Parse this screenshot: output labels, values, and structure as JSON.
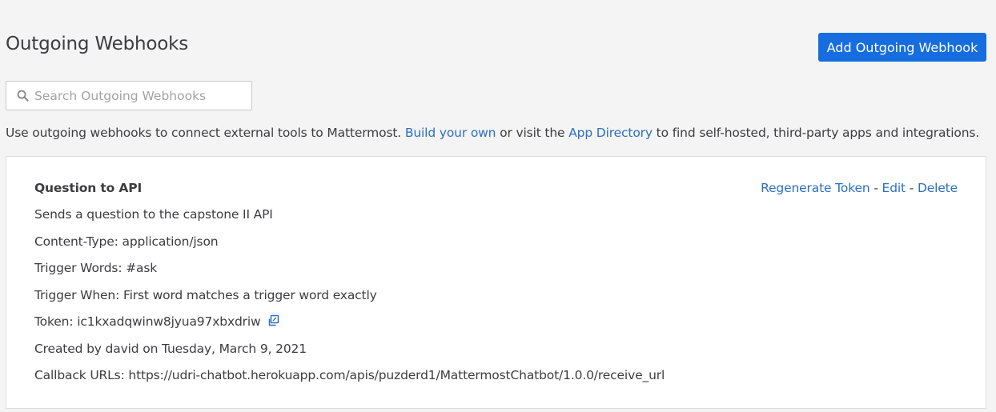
{
  "header": {
    "title": "Outgoing Webhooks",
    "add_button_label": "Add Outgoing Webhook"
  },
  "search": {
    "placeholder": "Search Outgoing Webhooks",
    "value": ""
  },
  "intro": {
    "text_before": "Use outgoing webhooks to connect external tools to Mattermost. ",
    "link_build": "Build your own",
    "text_middle": " or visit the ",
    "link_directory": "App Directory",
    "text_after": " to find self-hosted, third-party apps and integrations."
  },
  "webhook": {
    "title": "Question to API",
    "description": "Sends a question to the capstone II API",
    "content_type": "Content-Type: application/json",
    "trigger_words": "Trigger Words: #ask",
    "trigger_when": "Trigger When: First word matches a trigger word exactly",
    "token": "Token: ic1kxadqwinw8jyua97xbxdriw",
    "created": "Created by david on Tuesday, March 9, 2021",
    "callback_urls": "Callback URLs: https://udri-chatbot.herokuapp.com/apis/puzderd1/MattermostChatbot/1.0.0/receive_url",
    "actions": {
      "regenerate": "Regenerate Token",
      "separator": " - ",
      "edit": "Edit",
      "delete": "Delete"
    }
  },
  "icons": {
    "search": "search-icon",
    "copy": "copy-icon"
  },
  "colors": {
    "primary_button": "#166de0",
    "link": "#2d6fc0",
    "background": "#f4f4f4",
    "text": "#3d3c40"
  }
}
